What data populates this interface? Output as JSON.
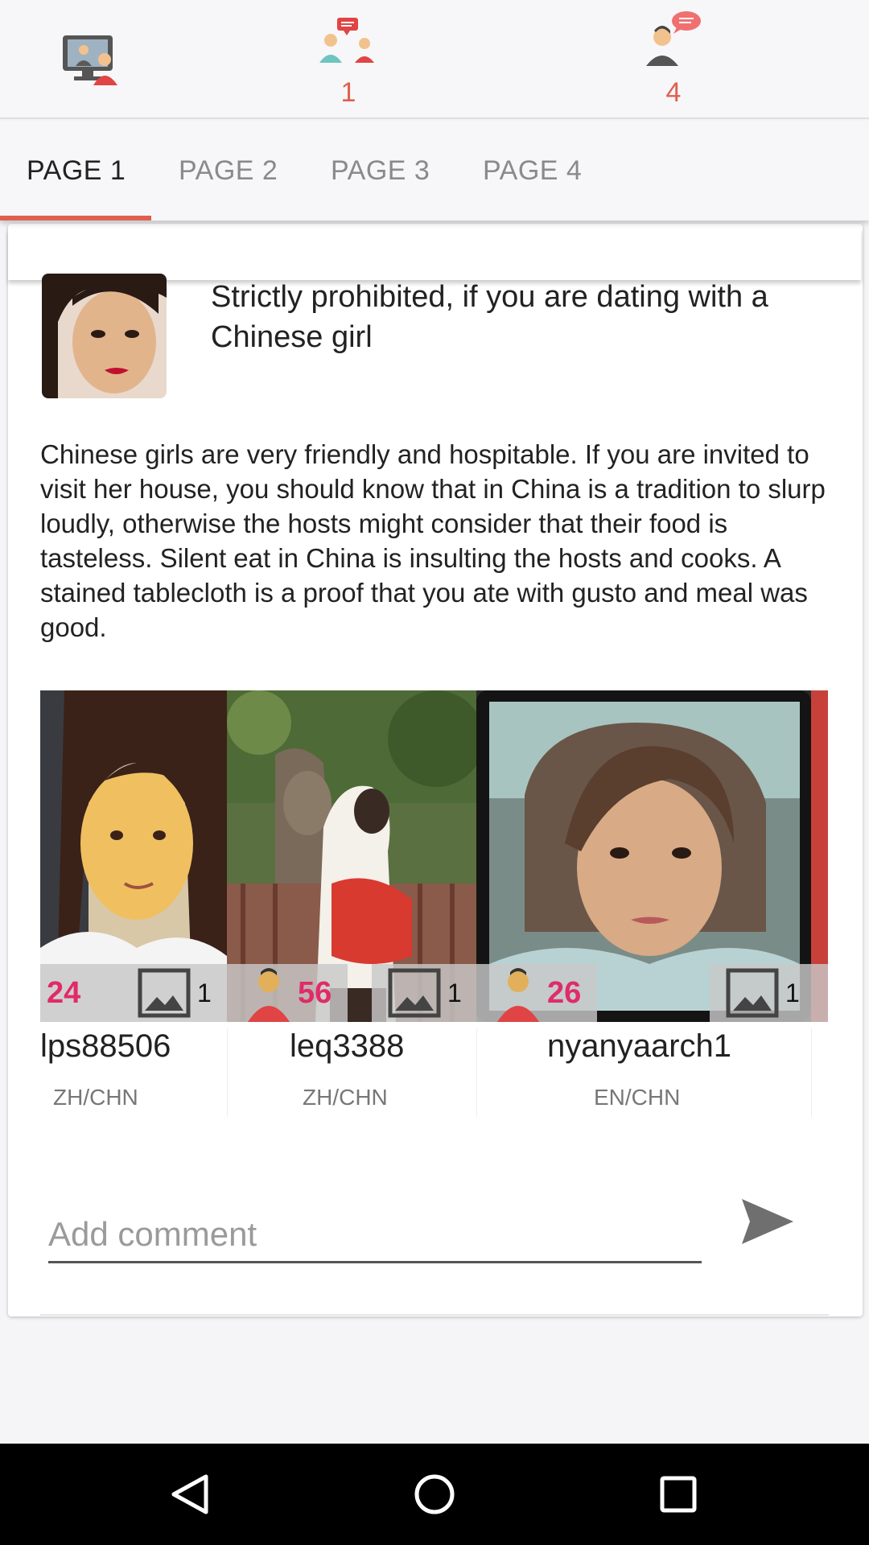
{
  "topbar": {
    "items": [
      {
        "name": "video-chat",
        "icon": "video-chat-icon",
        "count": ""
      },
      {
        "name": "conversations",
        "icon": "group-chat-icon",
        "count": "1"
      },
      {
        "name": "messages",
        "icon": "user-message-icon",
        "count": "4"
      }
    ]
  },
  "tabs": [
    "PAGE 1",
    "PAGE 2",
    "PAGE 3",
    "PAGE 4"
  ],
  "active_tab": 0,
  "colors": {
    "accent": "#e0604f",
    "age_badge": "#e02b6a",
    "navbar": "#000000"
  },
  "post": {
    "title": "Strictly prohibited, if you are dating with a Chinese girl",
    "body": "Chinese girls are very friendly and hospitable. If you are invited to visit her house, you should know that in China is a tradition to slurp loudly, otherwise the hosts might consider that their food is tasteless. Silent eat in China is insulting the hosts and cooks. A stained tablecloth is a proof that you ate with gusto and meal was good."
  },
  "gallery": [
    {
      "username": "lps88506",
      "lang": "ZH/CHN",
      "age": "24",
      "photos": "1"
    },
    {
      "username": "leq3388",
      "lang": "ZH/CHN",
      "age": "56",
      "photos": "1"
    },
    {
      "username": "nyanyaarch1",
      "lang": "EN/CHN",
      "age": "26",
      "photos": "1"
    }
  ],
  "comment": {
    "placeholder": "Add comment",
    "value": ""
  },
  "navbar": {
    "icons": [
      "back-icon",
      "home-icon",
      "recents-icon"
    ]
  }
}
